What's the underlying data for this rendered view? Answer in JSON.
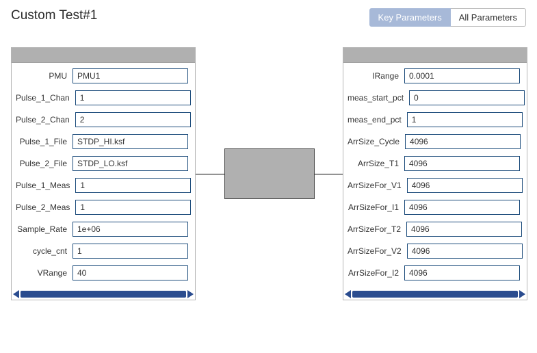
{
  "title": "Custom Test#1",
  "tabs": {
    "key": "Key Parameters",
    "all": "All Parameters"
  },
  "leftPanel": {
    "rows": [
      {
        "label": "PMU",
        "value": "PMU1"
      },
      {
        "label": "Pulse_1_Chan",
        "value": "1"
      },
      {
        "label": "Pulse_2_Chan",
        "value": "2"
      },
      {
        "label": "Pulse_1_File",
        "value": "STDP_HI.ksf"
      },
      {
        "label": "Pulse_2_File",
        "value": "STDP_LO.ksf"
      },
      {
        "label": "Pulse_1_Meas",
        "value": "1"
      },
      {
        "label": "Pulse_2_Meas",
        "value": "1"
      },
      {
        "label": "Sample_Rate",
        "value": "1e+06"
      },
      {
        "label": "cycle_cnt",
        "value": "1"
      },
      {
        "label": "VRange",
        "value": "40"
      }
    ]
  },
  "rightPanel": {
    "rows": [
      {
        "label": "IRange",
        "value": "0.0001"
      },
      {
        "label": "meas_start_pct",
        "value": "0"
      },
      {
        "label": "meas_end_pct",
        "value": "1"
      },
      {
        "label": "ArrSize_Cycle",
        "value": "4096"
      },
      {
        "label": "ArrSize_T1",
        "value": "4096"
      },
      {
        "label": "ArrSizeFor_V1",
        "value": "4096"
      },
      {
        "label": "ArrSizeFor_I1",
        "value": "4096"
      },
      {
        "label": "ArrSizeFor_T2",
        "value": "4096"
      },
      {
        "label": "ArrSizeFor_V2",
        "value": "4096"
      },
      {
        "label": "ArrSizeFor_I2",
        "value": "4096"
      }
    ]
  }
}
